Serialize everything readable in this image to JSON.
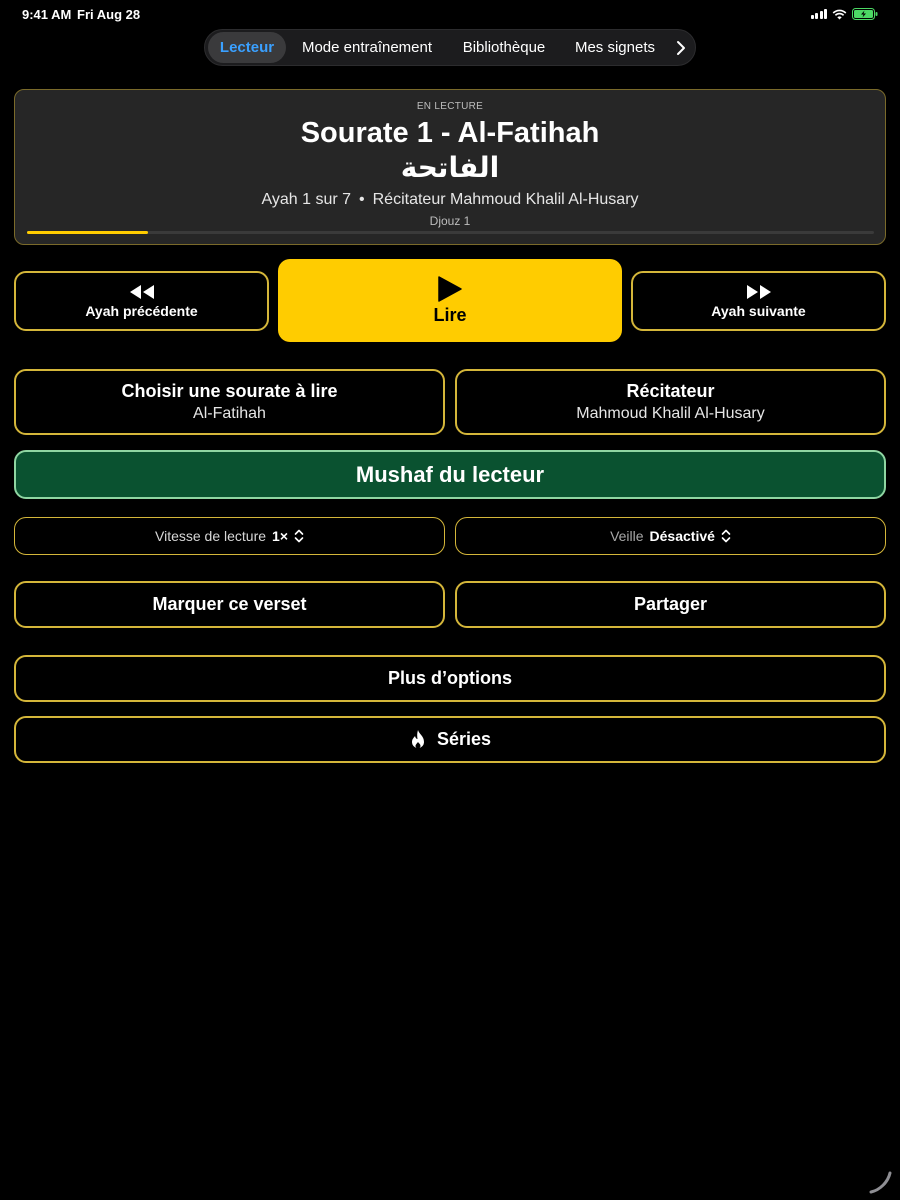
{
  "status_bar": {
    "time": "9:41 AM",
    "date": "Fri Aug 28",
    "icons": [
      "cellular-signal-icon",
      "wifi-icon",
      "battery-charging-icon"
    ]
  },
  "nav": {
    "tabs": [
      {
        "label": "Lecteur",
        "active": true
      },
      {
        "label": "Mode entraînement",
        "active": false
      },
      {
        "label": "Bibliothèque",
        "active": false
      },
      {
        "label": "Mes signets",
        "active": false
      }
    ],
    "more_icon": "chevron-right-icon"
  },
  "now_playing": {
    "kicker": "EN LECTURE",
    "title": "Sourate 1 - Al-Fatihah",
    "arabic_title": "الفاتحة",
    "ayah_info": "Ayah 1 sur 7",
    "reciter_info": "Récitateur Mahmoud Khalil Al-Husary",
    "juz": "Djouz 1",
    "progress_fraction": 0.143
  },
  "controls": {
    "prev_label": "Ayah précédente",
    "play_label": "Lire",
    "next_label": "Ayah suivante"
  },
  "selectors": {
    "surah_label": "Choisir une sourate à lire",
    "surah_value": "Al-Fatihah",
    "reciter_label": "Récitateur",
    "reciter_value": "Mahmoud Khalil Al-Husary"
  },
  "mushaf_label": "Mushaf du lecteur",
  "speed": {
    "label": "Vitesse de lecture",
    "value": "1×"
  },
  "sleep": {
    "label": "Veille",
    "value": "Désactivé"
  },
  "actions": {
    "mark_label": "Marquer ce verset",
    "share_label": "Partager",
    "options_label": "Plus d’options",
    "series_label": "Séries"
  },
  "colors": {
    "accent_yellow": "#ffcc00",
    "border_gold": "#d4b63a",
    "mushaf_green": "#0a5230",
    "active_tab_blue": "#3aa0ff"
  }
}
